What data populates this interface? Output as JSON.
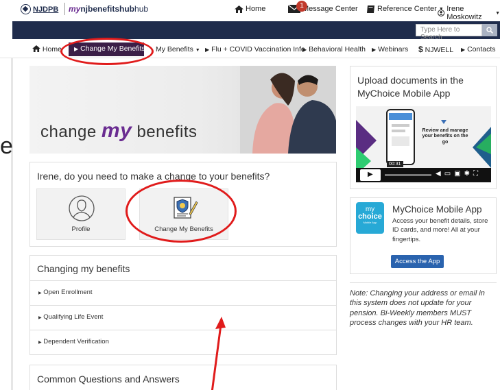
{
  "header": {
    "logo_org": "NJDPB",
    "logo_hub_my": "my",
    "logo_hub_nj": "nj",
    "logo_hub_rest": "benefitshub",
    "home": "Home",
    "message_center": "Message Center",
    "message_count": "1",
    "reference_center": "Reference Center",
    "user": "Irene Moskowitz"
  },
  "search": {
    "placeholder": "Type Here to Search"
  },
  "nav": {
    "items": [
      "Home",
      "Change My Benefits",
      "My Benefits",
      "Flu + COVID Vaccination Info",
      "Behavioral Health",
      "Webinars",
      "NJWELL",
      "Contacts"
    ]
  },
  "side_letter": "e",
  "hero": {
    "pre": "change",
    "my": "my",
    "post": "benefits"
  },
  "change_card": {
    "question": "Irene, do you need to make a change to your benefits?",
    "tiles": [
      "Profile",
      "Change My Benefits"
    ]
  },
  "changing_card": {
    "title": "Changing my benefits",
    "rows": [
      "Open Enrollment",
      "Qualifying Life Event",
      "Dependent Verification"
    ]
  },
  "faq": {
    "title": "Common Questions and Answers"
  },
  "upload_card": {
    "title": "Upload documents in the MyChoice Mobile App",
    "video_caption": "Review and manage your benefits on the go",
    "video_time": "00:31"
  },
  "app_card": {
    "icon_top": "my",
    "icon_mid": "choice",
    "icon_sub": "Mobile App",
    "title": "MyChoice Mobile App",
    "body": "Access your benefit details, store ID cards, and more! All at your fingertips.",
    "button": "Access the App"
  },
  "note": {
    "text": "Note: Changing your address or email in this system does not update for your pension. Bi-Weekly members MUST process changes with your HR team."
  },
  "colors": {
    "navy": "#1f2c4c",
    "purple": "#3b1e47",
    "accent_purple": "#6a2c91",
    "button_blue": "#2a63ae",
    "annotation_red": "#e01b1b"
  }
}
